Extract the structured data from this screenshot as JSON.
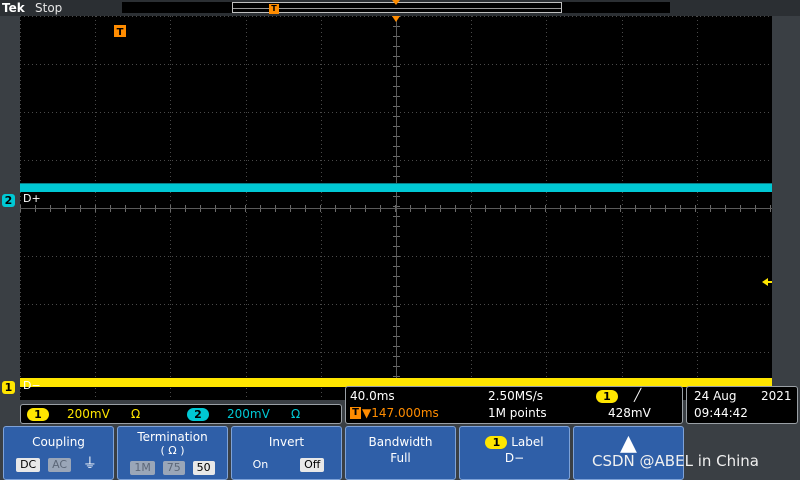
{
  "header": {
    "brand": "Tek",
    "status": "Stop"
  },
  "trigger_marker_glyph": "T",
  "channels": {
    "ch2": {
      "number": "2",
      "label": "D+",
      "color": "#00c8d4"
    },
    "ch1": {
      "number": "1",
      "label": "D−",
      "color": "#ffe600"
    }
  },
  "channel_panel": {
    "ch1": {
      "number": "1",
      "scale": "200mV",
      "coupling_icon": "Ω"
    },
    "ch2": {
      "number": "2",
      "scale": "200mV",
      "coupling_icon": "Ω"
    }
  },
  "timebase": {
    "time_div": "40.0ms",
    "sample_rate": "2.50MS/s",
    "trigger_delay": "▼147.000ms",
    "record_length": "1M points",
    "trigger_channel": "1",
    "trigger_slope": "╱",
    "trigger_level": "428mV"
  },
  "datetime": {
    "date_day": "24 Aug",
    "date_year": "2021",
    "time": "09:44:42"
  },
  "softkeys": {
    "coupling": {
      "title": "Coupling",
      "options": [
        "DC",
        "AC",
        "⏚"
      ]
    },
    "termination": {
      "title": "Termination",
      "subtitle": "( Ω )",
      "options": [
        "1M",
        "75",
        "50"
      ]
    },
    "invert": {
      "title": "Invert",
      "options": [
        "On",
        "Off"
      ]
    },
    "bandwidth": {
      "title": "Bandwidth",
      "value": "Full"
    },
    "label": {
      "number": "1",
      "title": "Label",
      "value": "D−"
    },
    "more": {
      "glyph": "▲"
    }
  },
  "watermark": "CSDN @ABEL in China"
}
